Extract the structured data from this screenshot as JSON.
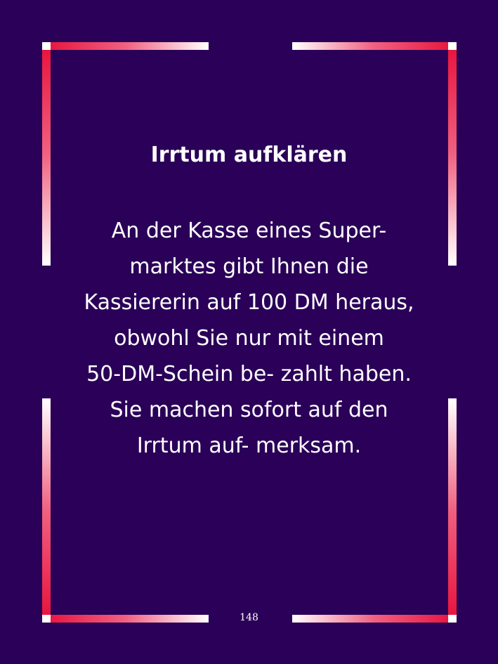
{
  "title": "Irrtum aufklären",
  "body_lines": [
    "An der Kasse eines Super-",
    "marktes gibt Ihnen die",
    "Kassiererin auf 100 DM heraus,",
    "obwohl Sie nur mit einem",
    "50-DM-Schein be- zahlt haben.",
    "Sie machen sofort auf den",
    "Irrtum auf- merksam."
  ],
  "page_number": "148",
  "colors": {
    "background": "#2a0058",
    "frame_red": "#e8103a",
    "frame_white": "#ffffff",
    "text": "#ffffff"
  }
}
